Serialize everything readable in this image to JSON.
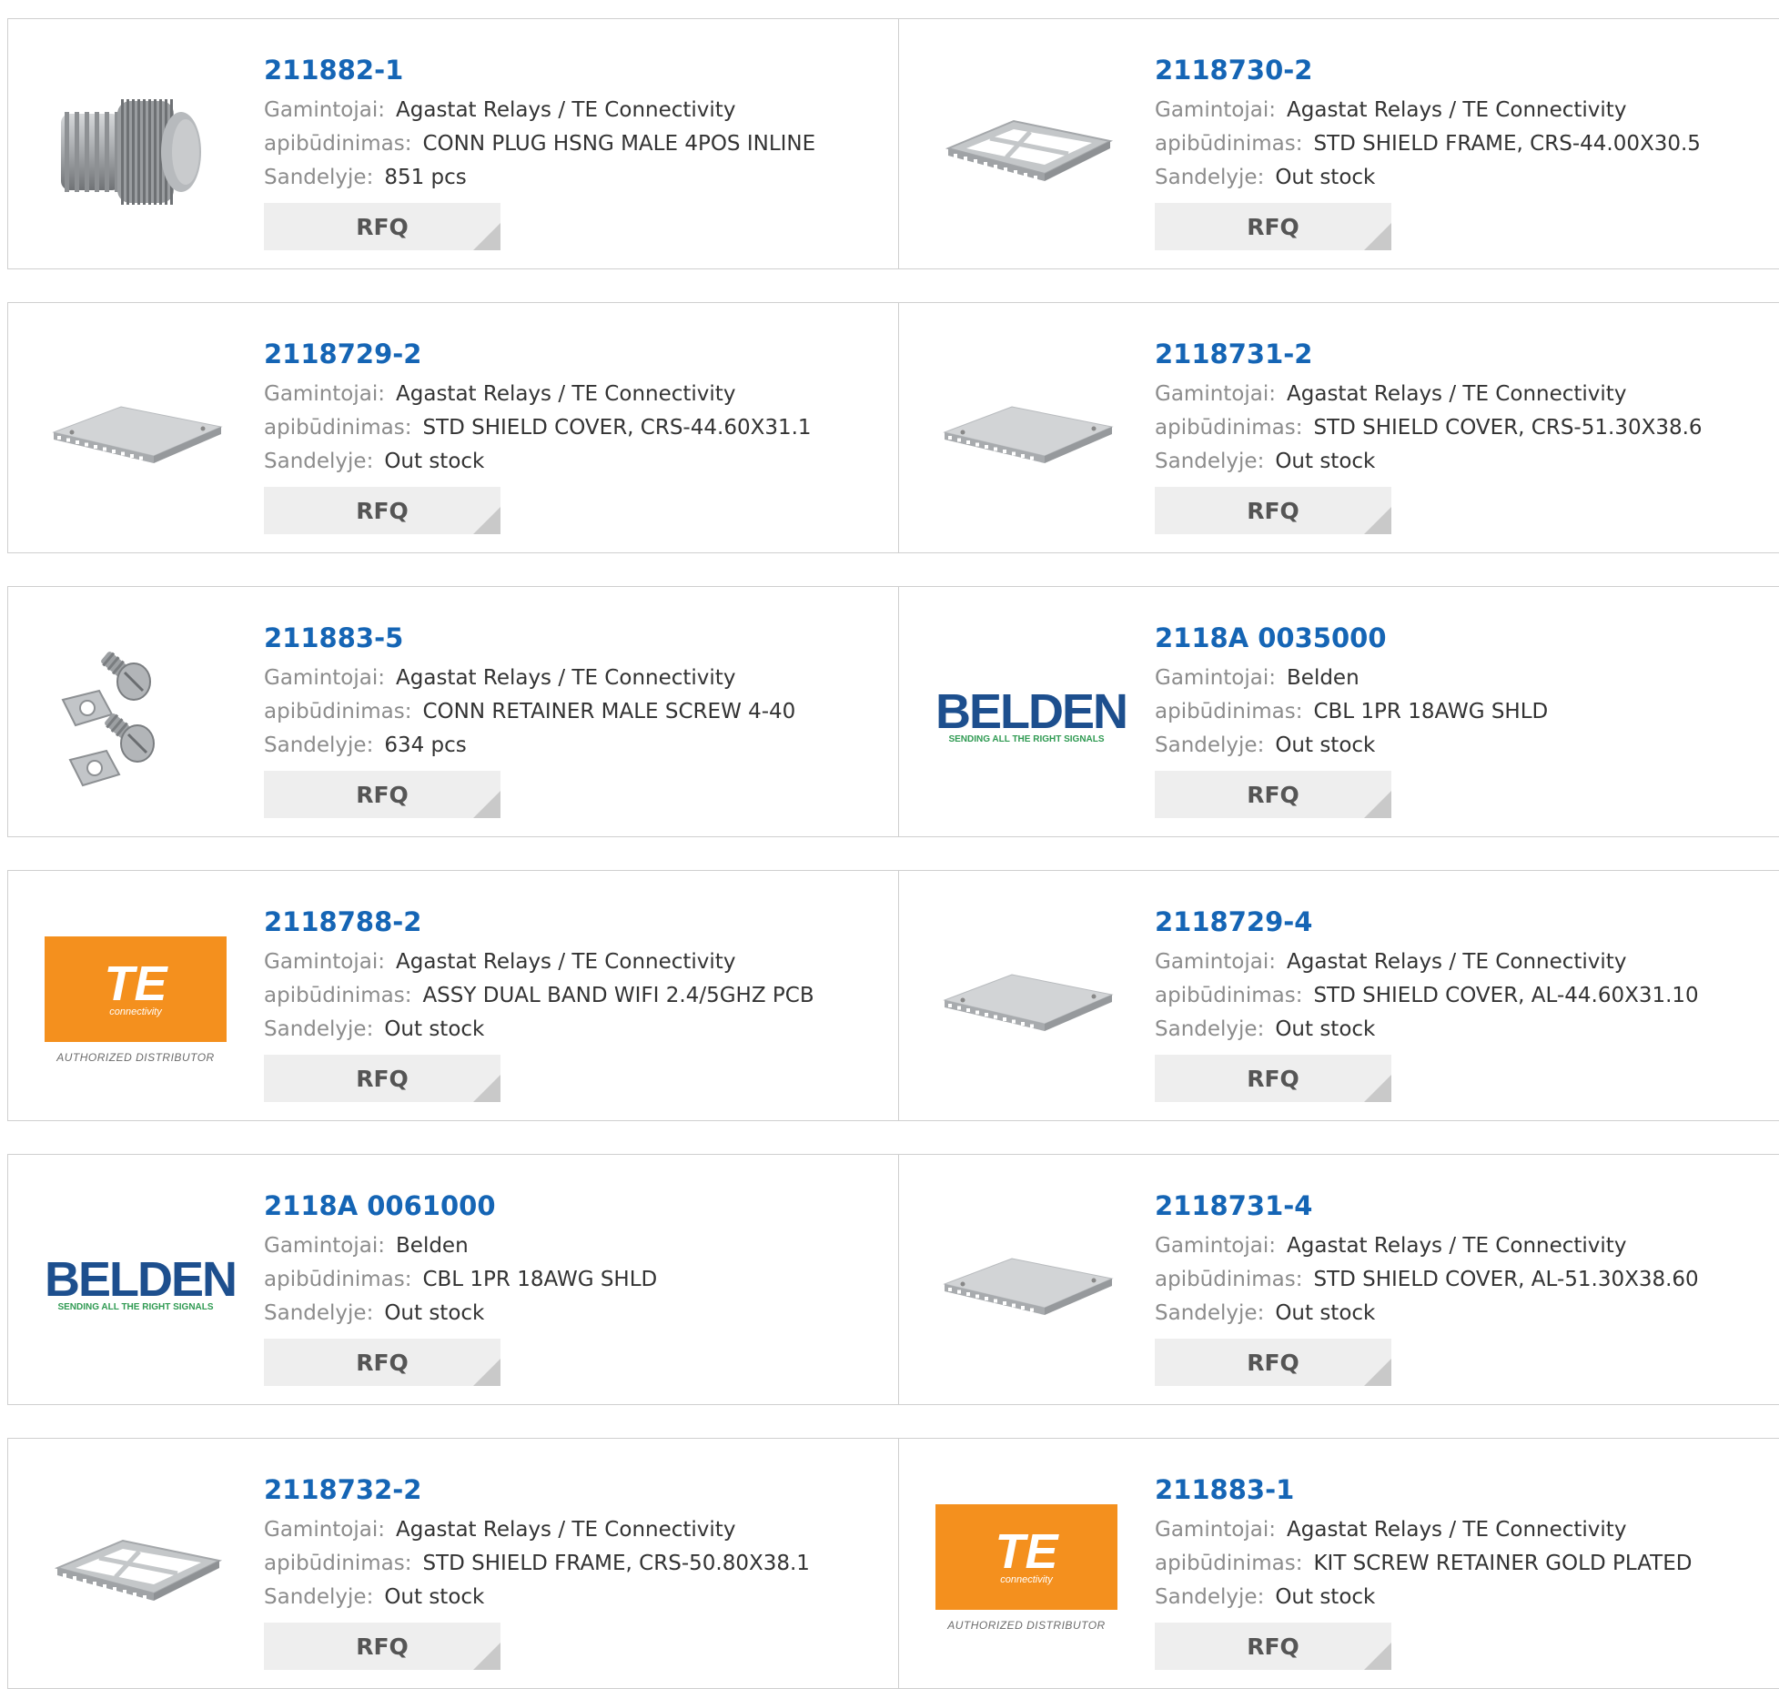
{
  "labels": {
    "manufacturer": "Gamintojai:",
    "description": "apibūdinimas:",
    "stock": "Sandelyje:",
    "rfq": "RFQ"
  },
  "colors": {
    "part_link": "#1565b5",
    "label": "#8c8c8c",
    "value": "#333333",
    "button_bg": "#eeeeee",
    "border": "#cfcfcf",
    "te_orange": "#f4901e",
    "belden_blue": "#1d4f8e"
  },
  "logo_text": {
    "belden_name": "BELDEN",
    "belden_tagline": "SENDING ALL THE RIGHT SIGNALS",
    "te_name": "TE",
    "te_sub": "connectivity",
    "te_caption": "AUTHORIZED DISTRIBUTOR"
  },
  "products": [
    {
      "part": "211882-1",
      "manufacturer": "Agastat Relays / TE Connectivity",
      "description": "CONN PLUG HSNG MALE 4POS INLINE",
      "stock": "851 pcs",
      "image": "connector-plug-icon"
    },
    {
      "part": "2118730-2",
      "manufacturer": "Agastat Relays / TE Connectivity",
      "description": "STD SHIELD FRAME, CRS-44.00X30.5",
      "stock": "Out stock",
      "image": "shield-frame-icon"
    },
    {
      "part": "2118729-2",
      "manufacturer": "Agastat Relays / TE Connectivity",
      "description": "STD SHIELD COVER, CRS-44.60X31.1",
      "stock": "Out stock",
      "image": "shield-cover-icon"
    },
    {
      "part": "2118731-2",
      "manufacturer": "Agastat Relays / TE Connectivity",
      "description": "STD SHIELD COVER, CRS-51.30X38.6",
      "stock": "Out stock",
      "image": "shield-cover-icon"
    },
    {
      "part": "211883-5",
      "manufacturer": "Agastat Relays / TE Connectivity",
      "description": "CONN RETAINER MALE SCREW 4-40",
      "stock": "634 pcs",
      "image": "screw-retainer-icon"
    },
    {
      "part": "2118A 0035000",
      "manufacturer": "Belden",
      "description": "CBL 1PR 18AWG SHLD",
      "stock": "Out stock",
      "image": "belden-logo"
    },
    {
      "part": "2118788-2",
      "manufacturer": "Agastat Relays / TE Connectivity",
      "description": "ASSY DUAL BAND WIFI 2.4/5GHZ PCB",
      "stock": "Out stock",
      "image": "te-logo"
    },
    {
      "part": "2118729-4",
      "manufacturer": "Agastat Relays / TE Connectivity",
      "description": "STD SHIELD COVER, AL-44.60X31.10",
      "stock": "Out stock",
      "image": "shield-cover-icon"
    },
    {
      "part": "2118A 0061000",
      "manufacturer": "Belden",
      "description": "CBL 1PR 18AWG SHLD",
      "stock": "Out stock",
      "image": "belden-logo"
    },
    {
      "part": "2118731-4",
      "manufacturer": "Agastat Relays / TE Connectivity",
      "description": "STD SHIELD COVER, AL-51.30X38.60",
      "stock": "Out stock",
      "image": "shield-cover-icon"
    },
    {
      "part": "2118732-2",
      "manufacturer": "Agastat Relays / TE Connectivity",
      "description": "STD SHIELD FRAME, CRS-50.80X38.1",
      "stock": "Out stock",
      "image": "shield-frame-icon"
    },
    {
      "part": "211883-1",
      "manufacturer": "Agastat Relays / TE Connectivity",
      "description": "KIT SCREW RETAINER GOLD PLATED",
      "stock": "Out stock",
      "image": "te-logo"
    }
  ]
}
